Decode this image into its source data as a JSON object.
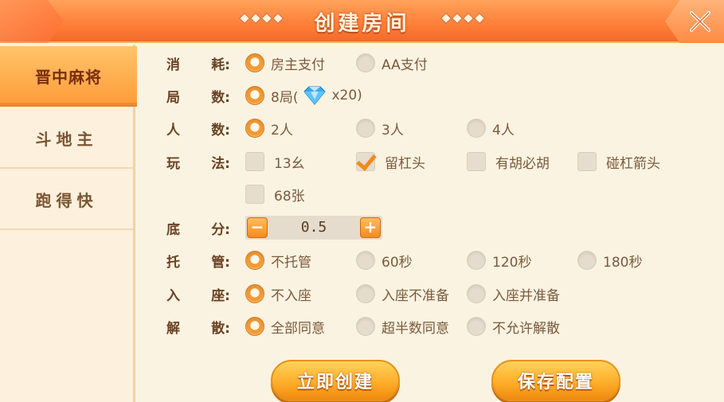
{
  "header": {
    "title": "创建房间"
  },
  "sidebar": {
    "items": [
      {
        "label": "晋中麻将",
        "active": true
      },
      {
        "label": "斗地主",
        "active": false
      },
      {
        "label": "跑得快",
        "active": false
      }
    ]
  },
  "form": {
    "consume": {
      "label1": "消",
      "label2": "耗:",
      "options": [
        "房主支付",
        "AA支付"
      ],
      "selected": 0
    },
    "rounds": {
      "label1": "局",
      "label2": "数:",
      "option_prefix": "8局(",
      "option_suffix": "x20)"
    },
    "players": {
      "label1": "人",
      "label2": "数:",
      "options": [
        "2人",
        "3人",
        "4人"
      ],
      "selected": 0
    },
    "play": {
      "label1": "玩",
      "label2": "法:",
      "options": [
        "13幺",
        "留杠头",
        "有胡必胡",
        "碰杠箭头",
        "68张"
      ],
      "checked": [
        false,
        true,
        false,
        false,
        false
      ]
    },
    "base": {
      "label1": "底",
      "label2": "分:",
      "value": "0.5",
      "minus": "−",
      "plus": "+"
    },
    "hosting": {
      "label1": "托",
      "label2": "管:",
      "options": [
        "不托管",
        "60秒",
        "120秒",
        "180秒"
      ],
      "selected": 0
    },
    "seat": {
      "label1": "入",
      "label2": "座:",
      "options": [
        "不入座",
        "入座不准备",
        "入座并准备"
      ],
      "selected": 0
    },
    "dissolve": {
      "label1": "解",
      "label2": "散:",
      "options": [
        "全部同意",
        "超半数同意",
        "不允许解散"
      ],
      "selected": 0
    }
  },
  "buttons": {
    "create": "立即创建",
    "save": "保存配置"
  },
  "colors": {
    "accent": "#ff8a3a",
    "selected": "#f39a34",
    "bg": "#fbf3e2"
  }
}
